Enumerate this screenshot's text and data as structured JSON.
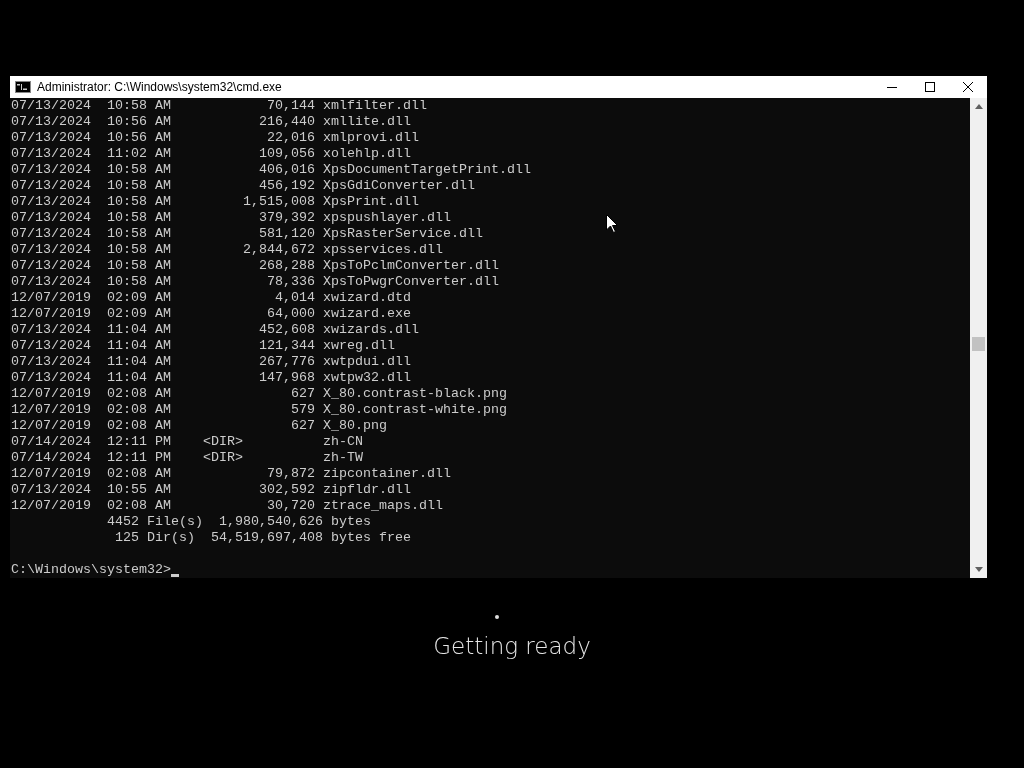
{
  "window": {
    "title": "Administrator: C:\\Windows\\system32\\cmd.exe"
  },
  "listing": [
    {
      "kind": "file",
      "date": "07/13/2024",
      "time": "10:58 AM",
      "size": "70,144",
      "name": "xmlfilter.dll"
    },
    {
      "kind": "file",
      "date": "07/13/2024",
      "time": "10:56 AM",
      "size": "216,440",
      "name": "xmllite.dll"
    },
    {
      "kind": "file",
      "date": "07/13/2024",
      "time": "10:56 AM",
      "size": "22,016",
      "name": "xmlprovi.dll"
    },
    {
      "kind": "file",
      "date": "07/13/2024",
      "time": "11:02 AM",
      "size": "109,056",
      "name": "xolehlp.dll"
    },
    {
      "kind": "file",
      "date": "07/13/2024",
      "time": "10:58 AM",
      "size": "406,016",
      "name": "XpsDocumentTargetPrint.dll"
    },
    {
      "kind": "file",
      "date": "07/13/2024",
      "time": "10:58 AM",
      "size": "456,192",
      "name": "XpsGdiConverter.dll"
    },
    {
      "kind": "file",
      "date": "07/13/2024",
      "time": "10:58 AM",
      "size": "1,515,008",
      "name": "XpsPrint.dll"
    },
    {
      "kind": "file",
      "date": "07/13/2024",
      "time": "10:58 AM",
      "size": "379,392",
      "name": "xpspushlayer.dll"
    },
    {
      "kind": "file",
      "date": "07/13/2024",
      "time": "10:58 AM",
      "size": "581,120",
      "name": "XpsRasterService.dll"
    },
    {
      "kind": "file",
      "date": "07/13/2024",
      "time": "10:58 AM",
      "size": "2,844,672",
      "name": "xpsservices.dll"
    },
    {
      "kind": "file",
      "date": "07/13/2024",
      "time": "10:58 AM",
      "size": "268,288",
      "name": "XpsToPclmConverter.dll"
    },
    {
      "kind": "file",
      "date": "07/13/2024",
      "time": "10:58 AM",
      "size": "78,336",
      "name": "XpsToPwgrConverter.dll"
    },
    {
      "kind": "file",
      "date": "12/07/2019",
      "time": "02:09 AM",
      "size": "4,014",
      "name": "xwizard.dtd"
    },
    {
      "kind": "file",
      "date": "12/07/2019",
      "time": "02:09 AM",
      "size": "64,000",
      "name": "xwizard.exe"
    },
    {
      "kind": "file",
      "date": "07/13/2024",
      "time": "11:04 AM",
      "size": "452,608",
      "name": "xwizards.dll"
    },
    {
      "kind": "file",
      "date": "07/13/2024",
      "time": "11:04 AM",
      "size": "121,344",
      "name": "xwreg.dll"
    },
    {
      "kind": "file",
      "date": "07/13/2024",
      "time": "11:04 AM",
      "size": "267,776",
      "name": "xwtpdui.dll"
    },
    {
      "kind": "file",
      "date": "07/13/2024",
      "time": "11:04 AM",
      "size": "147,968",
      "name": "xwtpw32.dll"
    },
    {
      "kind": "file",
      "date": "12/07/2019",
      "time": "02:08 AM",
      "size": "627",
      "name": "X_80.contrast-black.png"
    },
    {
      "kind": "file",
      "date": "12/07/2019",
      "time": "02:08 AM",
      "size": "579",
      "name": "X_80.contrast-white.png"
    },
    {
      "kind": "file",
      "date": "12/07/2019",
      "time": "02:08 AM",
      "size": "627",
      "name": "X_80.png"
    },
    {
      "kind": "dir",
      "date": "07/14/2024",
      "time": "12:11 PM",
      "size": "<DIR>",
      "name": "zh-CN"
    },
    {
      "kind": "dir",
      "date": "07/14/2024",
      "time": "12:11 PM",
      "size": "<DIR>",
      "name": "zh-TW"
    },
    {
      "kind": "file",
      "date": "12/07/2019",
      "time": "02:08 AM",
      "size": "79,872",
      "name": "zipcontainer.dll"
    },
    {
      "kind": "file",
      "date": "07/13/2024",
      "time": "10:55 AM",
      "size": "302,592",
      "name": "zipfldr.dll"
    },
    {
      "kind": "file",
      "date": "12/07/2019",
      "time": "02:08 AM",
      "size": "30,720",
      "name": "ztrace_maps.dll"
    }
  ],
  "summary": [
    "4452 File(s)  1,980,540,626 bytes",
    "125 Dir(s)  54,519,697,408 bytes free"
  ],
  "prompt": "C:\\Windows\\system32>",
  "status": "Getting ready"
}
